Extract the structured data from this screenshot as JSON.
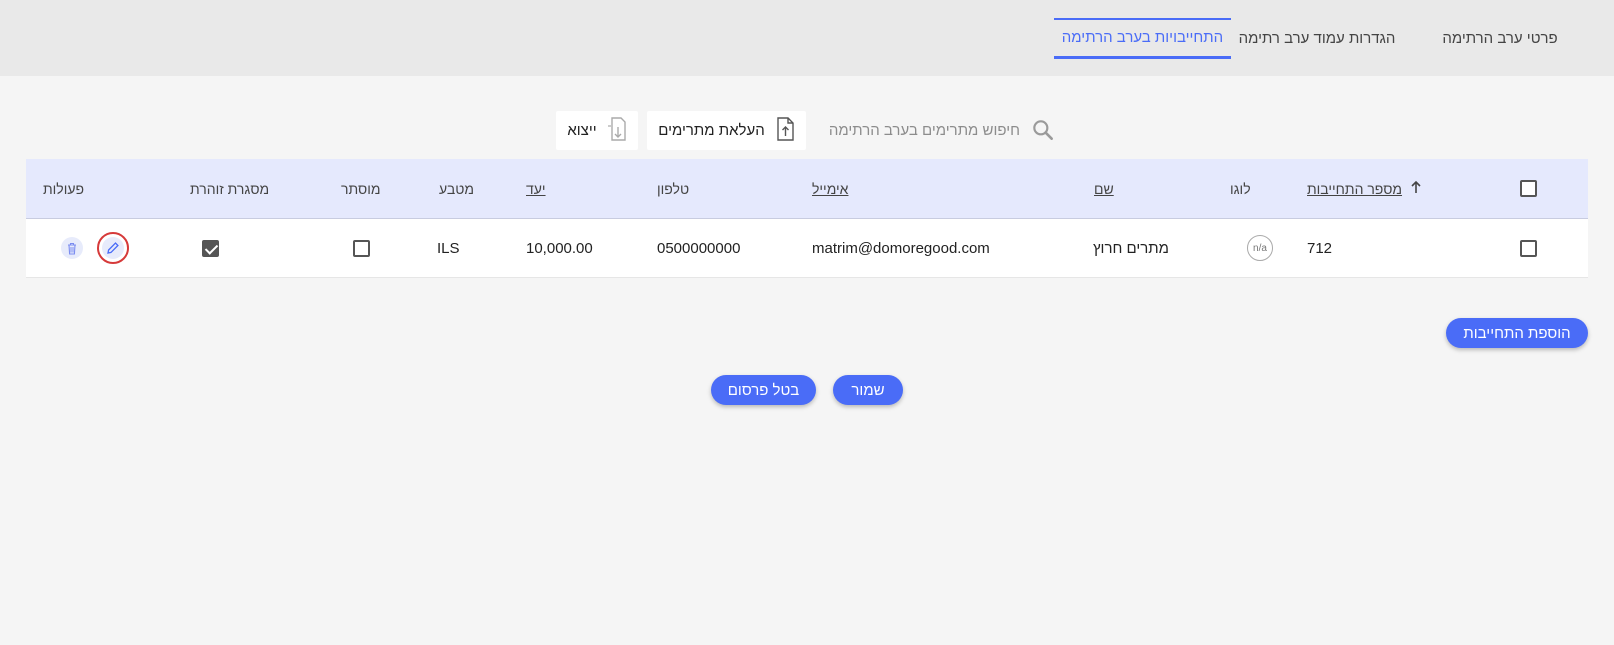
{
  "tabs": {
    "details": "פרטי ערב הרתימה",
    "page_settings": "הגדרות עמוד ערב רתימה",
    "commitments": "התחייבויות בערב הרתימה"
  },
  "toolbar": {
    "search_placeholder": "חיפוש מתרימים בערב הרתימה",
    "upload_label": "העלאת מתרימים",
    "export_label": "ייצוא"
  },
  "table": {
    "headers": {
      "commitment_number": "מספר התחייבות",
      "logo": "לוגו",
      "name": "שם",
      "email": "אימייל",
      "phone": "טלפון",
      "target": "יעד",
      "currency": "מטבע",
      "hidden": "מוסתר",
      "glowing_frame": "מסגרת זוהרת",
      "actions": "פעולות"
    },
    "rows": [
      {
        "selected": false,
        "commitment_number": "712",
        "logo": "n/a",
        "name": "מתרים חרוץ",
        "email": "matrim@domoregood.com",
        "phone": "0500000000",
        "target": "10,000.00",
        "currency": "ILS",
        "hidden": false,
        "glowing_frame": true
      }
    ]
  },
  "buttons": {
    "add_commitment": "הוספת התחייבות",
    "save": "שמור",
    "cancel_publish": "בטל פרסום"
  },
  "colors": {
    "accent": "#4a6cf7",
    "header_bg": "#e5e9fd",
    "highlight_ring": "#d63a3a"
  }
}
